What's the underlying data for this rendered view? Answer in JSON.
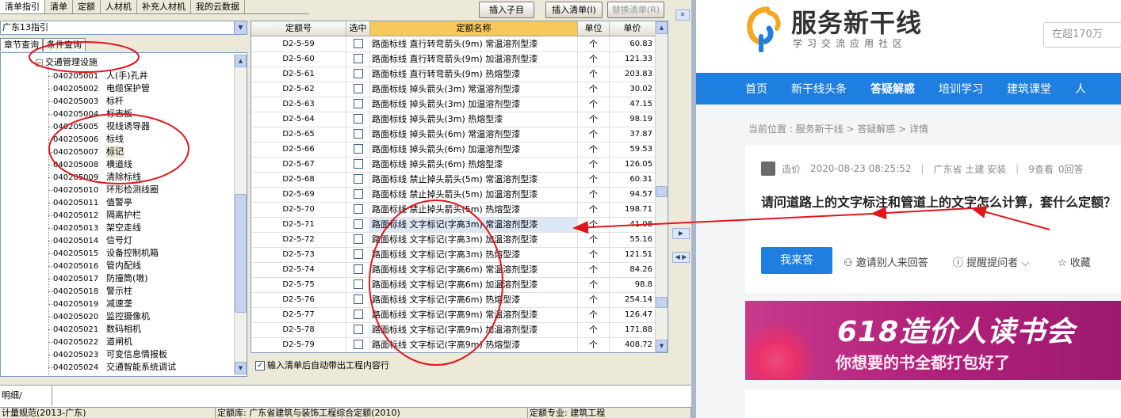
{
  "app": {
    "tabs": [
      "清单指引",
      "清单",
      "定额",
      "人材机",
      "补充人材机",
      "我的云数据"
    ],
    "buttons": {
      "insert_child": "插入子目",
      "insert_list": "插入清单(I)",
      "replace_list": "替换清单(R)"
    },
    "guide_select": "广东13指引",
    "subtabs": [
      "章节查询",
      "条件查询"
    ],
    "tree_root": "交通管理设施",
    "tree_root_toggle": "−",
    "tree_items": [
      {
        "code": "040205001",
        "name": "人(手)孔井"
      },
      {
        "code": "040205002",
        "name": "电缆保护管"
      },
      {
        "code": "040205003",
        "name": "标杆"
      },
      {
        "code": "040205004",
        "name": "标志板"
      },
      {
        "code": "040205005",
        "name": "视线诱导器"
      },
      {
        "code": "040205006",
        "name": "标线"
      },
      {
        "code": "040205007",
        "name": "标记"
      },
      {
        "code": "040205008",
        "name": "横道线"
      },
      {
        "code": "040205009",
        "name": "清除标线"
      },
      {
        "code": "040205010",
        "name": "环形检测线圈"
      },
      {
        "code": "040205011",
        "name": "值警亭"
      },
      {
        "code": "040205012",
        "name": "隔离护栏"
      },
      {
        "code": "040205013",
        "name": "架空走线"
      },
      {
        "code": "040205014",
        "name": "信号灯"
      },
      {
        "code": "040205015",
        "name": "设备控制机箱"
      },
      {
        "code": "040205016",
        "name": "管内配线"
      },
      {
        "code": "040205017",
        "name": "防撞筒(墩)"
      },
      {
        "code": "040205018",
        "name": "警示柱"
      },
      {
        "code": "040205019",
        "name": "减速垄"
      },
      {
        "code": "040205020",
        "name": "监控摄像机"
      },
      {
        "code": "040205021",
        "name": "数码相机"
      },
      {
        "code": "040205022",
        "name": "道闸机"
      },
      {
        "code": "040205023",
        "name": "可变信息情报板"
      },
      {
        "code": "040205024",
        "name": "交通智能系统调试"
      }
    ],
    "grid_headers": [
      "定额号",
      "选中",
      "定额名称",
      "单位",
      "单价"
    ],
    "grid_rows": [
      {
        "id": "D2-5-59",
        "name": "路面标线 直行转弯箭头(9m) 常温溶剂型漆",
        "unit": "个",
        "price": "60.83"
      },
      {
        "id": "D2-5-60",
        "name": "路面标线 直行转弯箭头(9m) 加温溶剂型漆",
        "unit": "个",
        "price": "121.33"
      },
      {
        "id": "D2-5-61",
        "name": "路面标线 直行转弯箭头(9m) 热熔型漆",
        "unit": "个",
        "price": "203.83"
      },
      {
        "id": "D2-5-62",
        "name": "路面标线 掉头箭头(3m) 常温溶剂型漆",
        "unit": "个",
        "price": "30.02"
      },
      {
        "id": "D2-5-63",
        "name": "路面标线 掉头箭头(3m) 加温溶剂型漆",
        "unit": "个",
        "price": "47.15"
      },
      {
        "id": "D2-5-64",
        "name": "路面标线 掉头箭头(3m) 热熔型漆",
        "unit": "个",
        "price": "98.19"
      },
      {
        "id": "D2-5-65",
        "name": "路面标线 掉头箭头(6m) 常温溶剂型漆",
        "unit": "个",
        "price": "37.87"
      },
      {
        "id": "D2-5-66",
        "name": "路面标线 掉头箭头(6m) 加温溶剂型漆",
        "unit": "个",
        "price": "59.53"
      },
      {
        "id": "D2-5-67",
        "name": "路面标线 掉头箭头(6m) 热熔型漆",
        "unit": "个",
        "price": "126.05"
      },
      {
        "id": "D2-5-68",
        "name": "路面标线 禁止掉头箭头(5m) 常温溶剂型漆",
        "unit": "个",
        "price": "60.31"
      },
      {
        "id": "D2-5-69",
        "name": "路面标线 禁止掉头箭头(5m) 加温溶剂型漆",
        "unit": "个",
        "price": "94.57"
      },
      {
        "id": "D2-5-70",
        "name": "路面标线 禁止掉头箭头(5m) 热熔型漆",
        "unit": "个",
        "price": "198.71"
      },
      {
        "id": "D2-5-71",
        "name": "路面标线 文字标记(字高3m) 常温溶剂型漆",
        "unit": "个",
        "price": "41.08"
      },
      {
        "id": "D2-5-72",
        "name": "路面标线 文字标记(字高3m) 加温溶剂型漆",
        "unit": "个",
        "price": "55.16"
      },
      {
        "id": "D2-5-73",
        "name": "路面标线 文字标记(字高3m) 热熔型漆",
        "unit": "个",
        "price": "121.51"
      },
      {
        "id": "D2-5-74",
        "name": "路面标线 文字标记(字高6m) 常温溶剂型漆",
        "unit": "个",
        "price": "84.26"
      },
      {
        "id": "D2-5-75",
        "name": "路面标线 文字标记(字高6m) 加温溶剂型漆",
        "unit": "个",
        "price": "98.8"
      },
      {
        "id": "D2-5-76",
        "name": "路面标线 文字标记(字高6m) 热熔型漆",
        "unit": "个",
        "price": "254.14"
      },
      {
        "id": "D2-5-77",
        "name": "路面标线 文字标记(字高9m) 常温溶剂型漆",
        "unit": "个",
        "price": "126.47"
      },
      {
        "id": "D2-5-78",
        "name": "路面标线 文字标记(字高9m) 加温溶剂型漆",
        "unit": "个",
        "price": "171.88"
      },
      {
        "id": "D2-5-79",
        "name": "路面标线 文字标记(字高9m) 热熔型漆",
        "unit": "个",
        "price": "408.72"
      }
    ],
    "auto_option": "输入清单后自动带出工程内容行",
    "bottom_tab": "明细/",
    "status": [
      "计量规范(2013-广东)",
      "定额库: 广东省建筑与装饰工程综合定额(2010)",
      "定额专业: 建筑工程"
    ]
  },
  "site": {
    "brand": "服务新干线",
    "slogan": "学习交流应用社区",
    "search_placeholder": "在超170万",
    "nav": [
      "首页",
      "新干线头条",
      "答疑解惑",
      "培训学习",
      "建筑课堂",
      "人"
    ],
    "breadcrumb": "当前位置 : 服务新干线 > 答疑解惑 > 详情",
    "question": {
      "user": "造价",
      "time": "2020-08-23 08:25:52",
      "tags": "广东省 土建 安装",
      "views": "9查看",
      "answers": "0回答",
      "title": "请问道路上的文字标注和管道上的文字怎么计算，套什么定额？"
    },
    "actions": {
      "answer": "我来答",
      "invite": "邀请别人来回答",
      "remind": "提醒提问者",
      "collect": "收藏"
    },
    "banner": {
      "headline": "618造价人读书会",
      "sub": "你想要的书全都打包好了"
    }
  },
  "colors": {
    "nav_blue": "#1e7fe0",
    "annotation_red": "#e0161b",
    "header_highlight": "#f7c95d",
    "banner_pink": "#c73a8c"
  }
}
